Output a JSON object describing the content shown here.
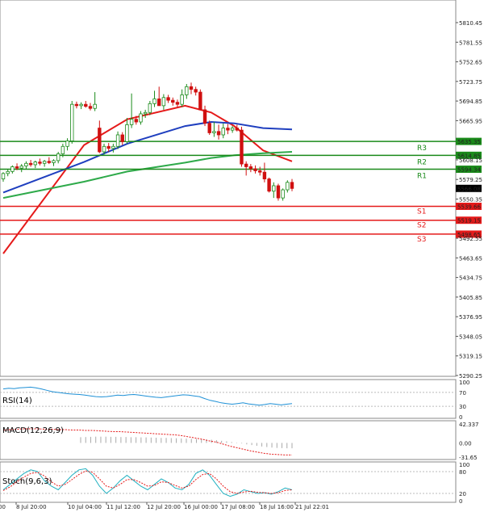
{
  "chart_data": {
    "type": "candlestick",
    "price_axis": {
      "min": 5290.25,
      "max": 5810.45,
      "ticks": [
        "5810.45",
        "5781.55",
        "5752.65",
        "5723.75",
        "5694.85",
        "5665.95",
        "5608.15",
        "5579.25",
        "5550.35",
        "5492.55",
        "5463.65",
        "5434.75",
        "5405.85",
        "5376.95",
        "5348.05",
        "5319.15",
        "5290.25"
      ]
    },
    "time_labels": [
      "8 Jul 20:00",
      "10 Jul 04:00",
      "11 Jul 12:00",
      "12 Jul 20:00",
      "16 Jul 00:00",
      "17 Jul 08:00",
      "18 Jul 16:00",
      "21 Jul 22:01"
    ],
    "time_label_partial": "00",
    "candles": [
      [
        5580,
        5590,
        5576,
        5588
      ],
      [
        5588,
        5594,
        5584,
        5591
      ],
      [
        5591,
        5600,
        5588,
        5598
      ],
      [
        5598,
        5603,
        5593,
        5596
      ],
      [
        5596,
        5602,
        5590,
        5599
      ],
      [
        5599,
        5606,
        5595,
        5603
      ],
      [
        5603,
        5608,
        5598,
        5601
      ],
      [
        5601,
        5607,
        5596,
        5605
      ],
      [
        5605,
        5610,
        5600,
        5603
      ],
      [
        5603,
        5608,
        5598,
        5606
      ],
      [
        5606,
        5612,
        5602,
        5604
      ],
      [
        5604,
        5609,
        5599,
        5607
      ],
      [
        5607,
        5620,
        5603,
        5617
      ],
      [
        5617,
        5632,
        5612,
        5628
      ],
      [
        5628,
        5640,
        5622,
        5636
      ],
      [
        5636,
        5695,
        5632,
        5690
      ],
      [
        5690,
        5694,
        5684,
        5688
      ],
      [
        5688,
        5693,
        5683,
        5690
      ],
      [
        5690,
        5695,
        5685,
        5687
      ],
      [
        5687,
        5692,
        5681,
        5684
      ],
      [
        5684,
        5708,
        5680,
        5690
      ],
      [
        5655,
        5666,
        5618,
        5620
      ],
      [
        5620,
        5632,
        5616,
        5628
      ],
      [
        5628,
        5633,
        5620,
        5625
      ],
      [
        5625,
        5632,
        5619,
        5628
      ],
      [
        5628,
        5650,
        5624,
        5645
      ],
      [
        5645,
        5649,
        5630,
        5635
      ],
      [
        5635,
        5670,
        5632,
        5660
      ],
      [
        5660,
        5706,
        5655,
        5668
      ],
      [
        5668,
        5673,
        5660,
        5664
      ],
      [
        5664,
        5680,
        5660,
        5676
      ],
      [
        5676,
        5682,
        5670,
        5678
      ],
      [
        5678,
        5695,
        5674,
        5691
      ],
      [
        5691,
        5710,
        5686,
        5698
      ],
      [
        5698,
        5716,
        5690,
        5688
      ],
      [
        5688,
        5705,
        5682,
        5700
      ],
      [
        5700,
        5704,
        5692,
        5696
      ],
      [
        5696,
        5700,
        5688,
        5693
      ],
      [
        5693,
        5697,
        5686,
        5690
      ],
      [
        5690,
        5712,
        5686,
        5704
      ],
      [
        5704,
        5720,
        5698,
        5716
      ],
      [
        5716,
        5722,
        5705,
        5712
      ],
      [
        5712,
        5716,
        5703,
        5708
      ],
      [
        5708,
        5712,
        5694,
        5682
      ],
      [
        5682,
        5688,
        5658,
        5662
      ],
      [
        5662,
        5666,
        5645,
        5648
      ],
      [
        5648,
        5664,
        5642,
        5650
      ],
      [
        5650,
        5660,
        5638,
        5645
      ],
      [
        5645,
        5662,
        5640,
        5655
      ],
      [
        5655,
        5661,
        5646,
        5652
      ],
      [
        5652,
        5658,
        5648,
        5655
      ],
      [
        5655,
        5660,
        5650,
        5652
      ],
      [
        5652,
        5657,
        5598,
        5602
      ],
      [
        5602,
        5606,
        5585,
        5598
      ],
      [
        5598,
        5602,
        5590,
        5595
      ],
      [
        5595,
        5600,
        5588,
        5592
      ],
      [
        5592,
        5598,
        5585,
        5590
      ],
      [
        5590,
        5604,
        5575,
        5580
      ],
      [
        5580,
        5582,
        5560,
        5562
      ],
      [
        5562,
        5575,
        5552,
        5570
      ],
      [
        5570,
        5573,
        5548,
        5552
      ],
      [
        5552,
        5566,
        5548,
        5564
      ],
      [
        5564,
        5578,
        5560,
        5575
      ],
      [
        5575,
        5580,
        5562,
        5566
      ]
    ],
    "series": [
      {
        "name": "",
        "color": "#e51a1a",
        "values": [
          [
            0,
            5470
          ],
          [
            0.28,
            5630
          ],
          [
            0.43,
            5668
          ],
          [
            0.63,
            5688
          ],
          [
            0.72,
            5678
          ],
          [
            0.8,
            5658
          ],
          [
            0.9,
            5622
          ],
          [
            1.0,
            5606
          ]
        ]
      },
      {
        "name": "",
        "color": "#1f3fbf",
        "values": [
          [
            0,
            5560
          ],
          [
            0.28,
            5605
          ],
          [
            0.43,
            5632
          ],
          [
            0.63,
            5658
          ],
          [
            0.72,
            5664
          ],
          [
            0.8,
            5662
          ],
          [
            0.9,
            5655
          ],
          [
            1.0,
            5653
          ]
        ]
      },
      {
        "name": "",
        "color": "#2eaa4a",
        "values": [
          [
            0,
            5552
          ],
          [
            0.28,
            5576
          ],
          [
            0.43,
            5591
          ],
          [
            0.63,
            5604
          ],
          [
            0.72,
            5611
          ],
          [
            0.8,
            5615
          ],
          [
            0.9,
            5618
          ],
          [
            1.0,
            5620
          ]
        ]
      }
    ],
    "levels": [
      {
        "name": "R3",
        "value": 5635.35,
        "label": "5635.35",
        "color": "#1a8a1a"
      },
      {
        "name": "R2",
        "value": 5614.85,
        "label": "5614.85",
        "color": "#1a8a1a"
      },
      {
        "name": "R1",
        "value": 5594.34,
        "label": "5594.34",
        "color": "#1a8a1a"
      },
      {
        "name": "S1",
        "value": 5539.66,
        "label": "5539.66",
        "color": "#e51a1a"
      },
      {
        "name": "S2",
        "value": 5519.15,
        "label": "5519.15",
        "color": "#e51a1a"
      },
      {
        "name": "S3",
        "value": 5498.65,
        "label": "5498.65",
        "color": "#e51a1a"
      }
    ],
    "current_price": "5566.08",
    "rsi": {
      "label": "RSI(14)",
      "ticks": [
        "100",
        "70",
        "30",
        "0"
      ],
      "values": [
        80,
        82,
        81,
        83,
        84,
        85,
        83,
        80,
        76,
        72,
        70,
        68,
        66,
        65,
        64,
        62,
        60,
        58,
        57,
        58,
        60,
        62,
        61,
        63,
        64,
        62,
        60,
        58,
        56,
        55,
        57,
        59,
        61,
        63,
        62,
        60,
        58,
        52,
        47,
        44,
        40,
        38,
        36,
        38,
        40,
        37,
        35,
        33,
        35,
        38,
        36,
        34,
        36,
        38
      ]
    },
    "macd": {
      "label": "MACD(12,26,9)",
      "ticks": [
        "42.337",
        "0.00",
        "-31.65"
      ],
      "values": [
        32,
        33,
        34,
        35,
        35,
        35,
        34,
        34,
        33,
        33,
        32,
        32,
        31,
        31,
        30,
        29,
        28,
        28,
        27,
        26,
        25,
        24,
        23,
        22,
        21,
        20,
        18,
        15,
        12,
        9,
        5,
        2,
        -3,
        -8,
        -12,
        -16,
        -20,
        -23,
        -26,
        -28,
        -29,
        -30,
        -30
      ]
    },
    "stoch": {
      "label": "Stoch(9,6,3)",
      "ticks": [
        "100",
        "80",
        "20",
        "0"
      ],
      "k": [
        30,
        45,
        60,
        75,
        85,
        80,
        55,
        40,
        30,
        50,
        70,
        85,
        88,
        70,
        40,
        20,
        35,
        55,
        70,
        55,
        40,
        30,
        45,
        60,
        50,
        35,
        30,
        45,
        75,
        85,
        70,
        45,
        20,
        12,
        18,
        30,
        25,
        20,
        22,
        18,
        25,
        35,
        30
      ],
      "d": [
        28,
        38,
        52,
        65,
        75,
        78,
        68,
        52,
        40,
        45,
        58,
        72,
        82,
        78,
        60,
        40,
        35,
        45,
        58,
        58,
        50,
        40,
        42,
        52,
        50,
        42,
        35,
        40,
        58,
        72,
        75,
        60,
        40,
        25,
        20,
        24,
        26,
        23,
        22,
        20,
        22,
        28,
        30
      ]
    }
  }
}
